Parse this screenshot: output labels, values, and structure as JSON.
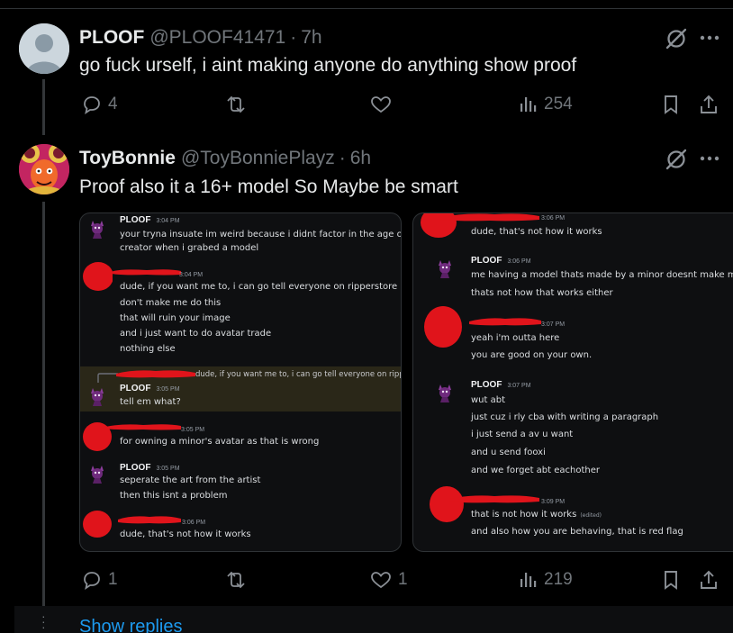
{
  "tweets": [
    {
      "display_name": "PLOOF",
      "handle": "@PLOOF41471",
      "separator": "·",
      "time": "7h",
      "text": "go fuck urself, i aint making anyone do anything show proof",
      "replies": "4",
      "retweets": "",
      "likes": "",
      "views": "254"
    },
    {
      "display_name": "ToyBonnie",
      "handle": "@ToyBonniePlayz",
      "separator": "·",
      "time": "6h",
      "text": "Proof also it a 16+ model So Maybe be smart",
      "replies": "1",
      "retweets": "",
      "likes": "1",
      "views": "219"
    }
  ],
  "screenshot": {
    "left": {
      "m1": {
        "name": "PLOOF",
        "time": "3:04 PM",
        "lines": [
          "your tryna insuate im weird because i didnt factor in the age of a",
          "creator when i grabed a model"
        ]
      },
      "m2": {
        "time": "3:04 PM",
        "lines": [
          "dude, if you want me to, i can go tell everyone on ripperstore",
          "don't make me do this",
          "that will ruin your image",
          "and i just want to do avatar trade",
          "nothing else"
        ]
      },
      "m3_reply": "dude, if you want me to, i can go tell everyone on ripp...",
      "m3": {
        "name": "PLOOF",
        "time": "3:05 PM",
        "lines": [
          "tell em what?"
        ]
      },
      "m4": {
        "time": "3:05 PM",
        "lines": [
          "for owning a minor's avatar as that is wrong"
        ]
      },
      "m5": {
        "name": "PLOOF",
        "time": "3:05 PM",
        "lines": [
          "seperate the art from the artist",
          "then this isnt a problem"
        ]
      },
      "m6": {
        "time": "3:06 PM",
        "lines": [
          "dude, that's not how it works"
        ]
      }
    },
    "right": {
      "m1": {
        "time": "3:06 PM",
        "lines": [
          "dude, that's not how it works"
        ]
      },
      "m2": {
        "name": "PLOOF",
        "time": "3:06 PM",
        "lines": [
          "me having a model thats made by a minor doesnt make m",
          "thats not how that works either"
        ]
      },
      "m3": {
        "time": "3:07 PM",
        "lines": [
          "yeah i'm outta here",
          "you  are good on your own."
        ]
      },
      "m4": {
        "name": "PLOOF",
        "time": "3:07 PM",
        "lines": [
          "wut abt",
          "just cuz i rly cba with writing a paragraph",
          "i just send a av u want",
          "and u send fooxi",
          "and we forget abt eachother"
        ]
      },
      "m5": {
        "time": "3:09 PM",
        "lines": [
          "that is not how it works",
          "and also how you are behaving, that is red flag"
        ],
        "edited": "(edited)"
      }
    }
  },
  "show_replies": "Show replies",
  "colors": {
    "background": "#000000",
    "text": "#e7e9ea",
    "muted": "#71767b",
    "link": "#1d9bf0",
    "redaction": "#e0141b"
  },
  "icons": [
    "grok-icon",
    "more-icon",
    "reply-icon",
    "retweet-icon",
    "like-icon",
    "views-icon",
    "bookmark-icon",
    "share-icon"
  ]
}
